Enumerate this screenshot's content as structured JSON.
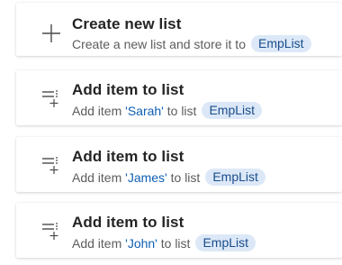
{
  "actions": [
    {
      "title": "Create new list",
      "desc_prefix": "Create a new list and store it to",
      "variable": "EmpList",
      "icon": "plus-icon"
    },
    {
      "title": "Add item to list",
      "desc_prefix": "Add item",
      "item": "'Sarah'",
      "desc_middle": "to list",
      "variable": "EmpList",
      "icon": "add-list-item-icon"
    },
    {
      "title": "Add item to list",
      "desc_prefix": "Add item",
      "item": "'James'",
      "desc_middle": "to list",
      "variable": "EmpList",
      "icon": "add-list-item-icon"
    },
    {
      "title": "Add item to list",
      "desc_prefix": "Add item",
      "item": "'John'",
      "desc_middle": "to list",
      "variable": "EmpList",
      "icon": "add-list-item-icon"
    }
  ],
  "colors": {
    "title": "#242424",
    "description": "#5c5c5c",
    "literal": "#0f5fb5",
    "badge_bg": "#dce8f7",
    "badge_text": "#1a4d8c"
  }
}
